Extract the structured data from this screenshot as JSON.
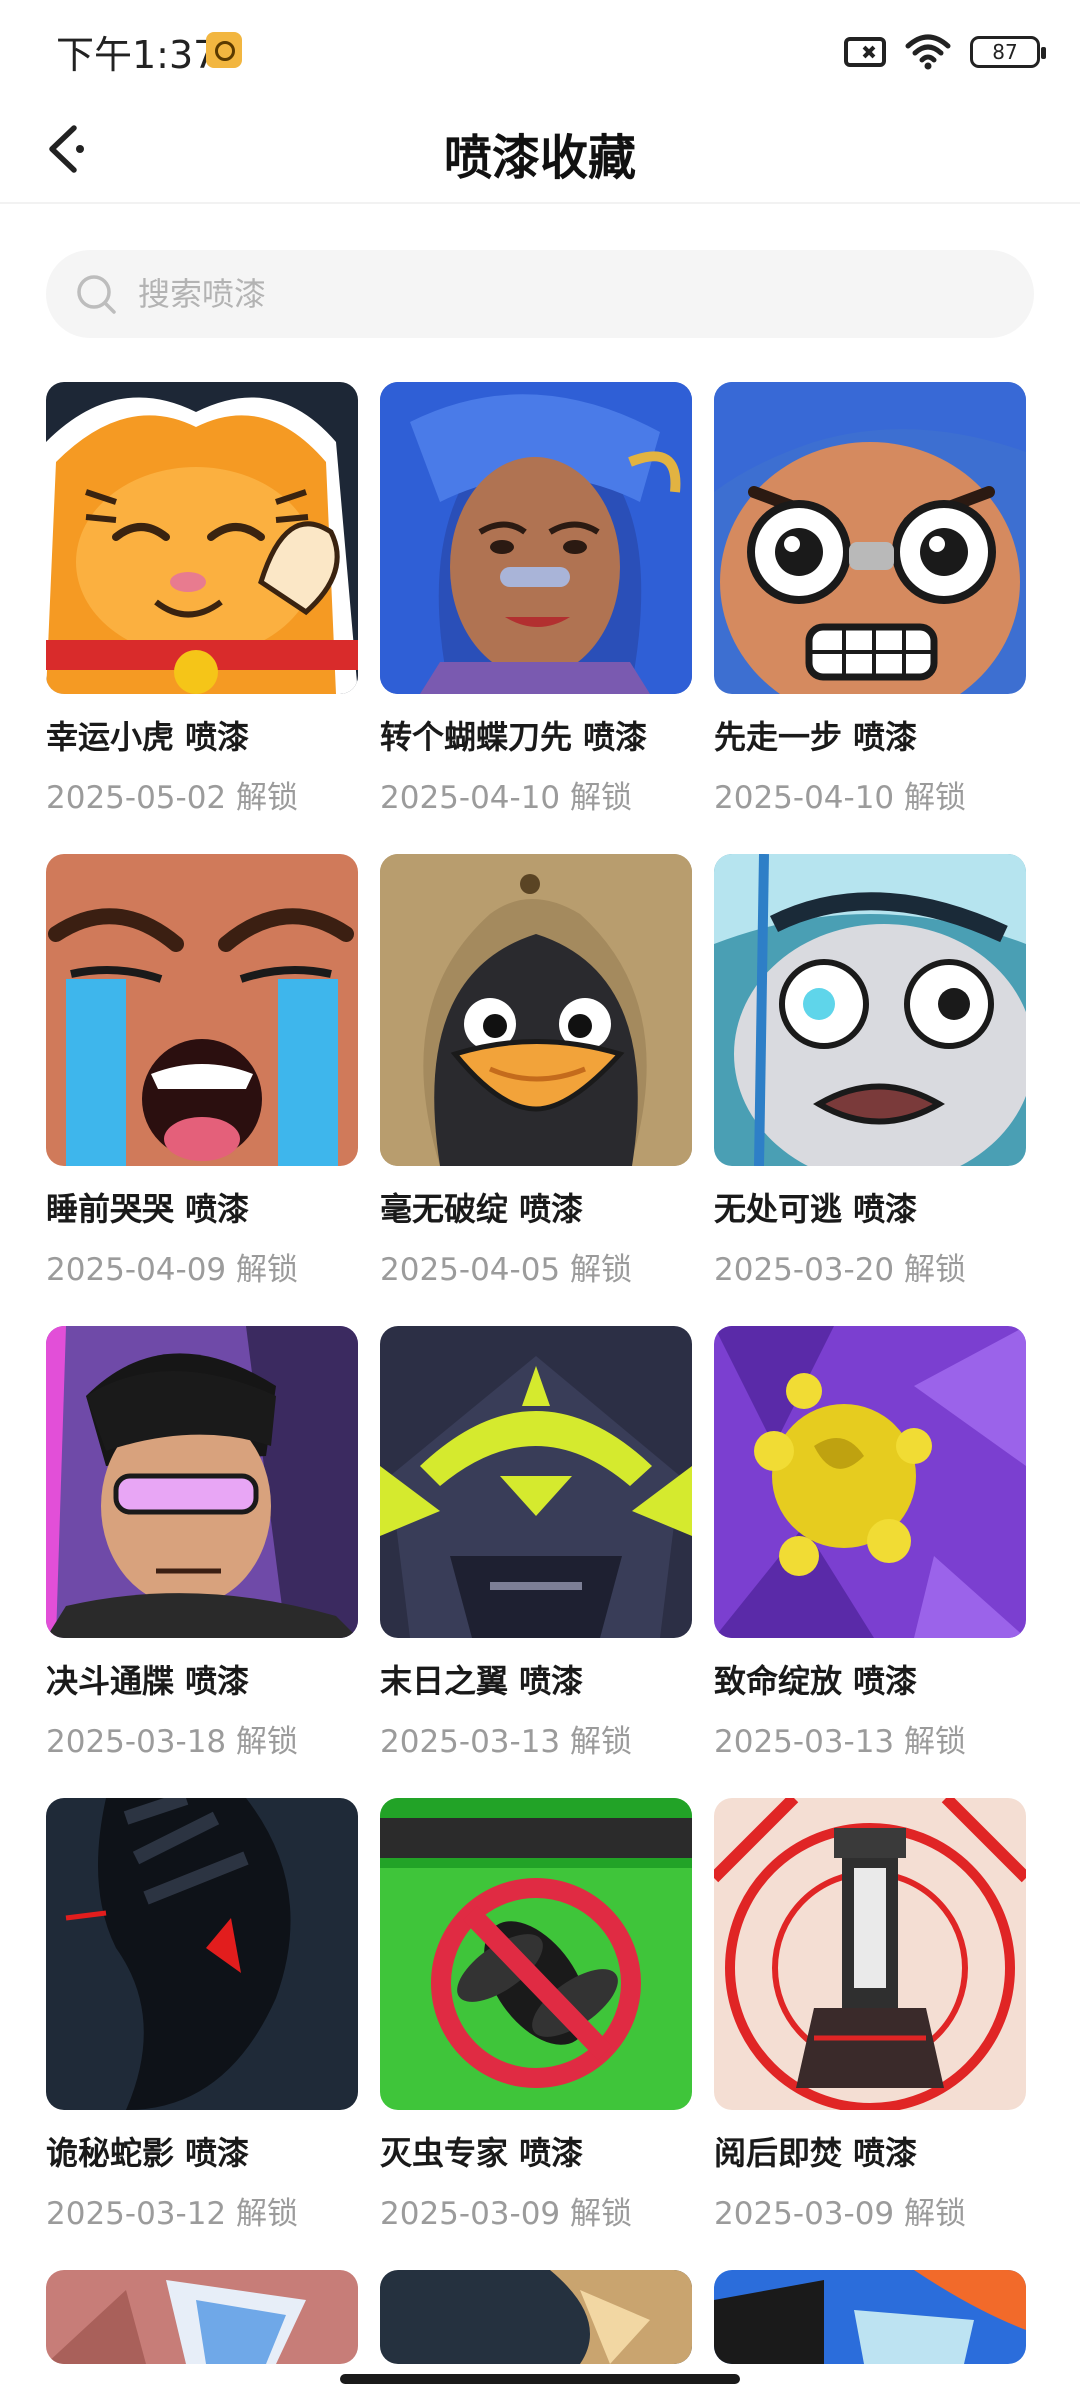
{
  "status_bar": {
    "time": "下午1:37",
    "battery": "87"
  },
  "header": {
    "title": "喷漆收藏"
  },
  "search": {
    "placeholder": "搜索喷漆",
    "value": ""
  },
  "items": [
    {
      "title": "幸运小虎 喷漆",
      "subtitle": "2025-05-02 解锁",
      "image": "lucky-tiger-spray"
    },
    {
      "title": "转个蝴蝶刀先 喷漆",
      "subtitle": "2025-04-10 解锁",
      "image": "blue-hair-woman-spray"
    },
    {
      "title": "先走一步 喷漆",
      "subtitle": "2025-04-10 解锁",
      "image": "shocked-boy-spray"
    },
    {
      "title": "睡前哭哭 喷漆",
      "subtitle": "2025-04-09 解锁",
      "image": "crying-face-spray"
    },
    {
      "title": "毫无破绽 喷漆",
      "subtitle": "2025-04-05 解锁",
      "image": "penguin-spray"
    },
    {
      "title": "无处可逃 喷漆",
      "subtitle": "2025-03-20 解锁",
      "image": "scared-face-spray"
    },
    {
      "title": "决斗通牒 喷漆",
      "subtitle": "2025-03-18 解锁",
      "image": "visor-fighter-spray"
    },
    {
      "title": "末日之翼 喷漆",
      "subtitle": "2025-03-13 解锁",
      "image": "dark-robot-spray"
    },
    {
      "title": "致命绽放 喷漆",
      "subtitle": "2025-03-13 解锁",
      "image": "yellow-flower-spray"
    },
    {
      "title": "诡秘蛇影 喷漆",
      "subtitle": "2025-03-12 解锁",
      "image": "shadow-snake-spray"
    },
    {
      "title": "灭虫专家 喷漆",
      "subtitle": "2025-03-09 解锁",
      "image": "no-bug-spray"
    },
    {
      "title": "阅后即焚 喷漆",
      "subtitle": "2025-03-09 解锁",
      "image": "red-target-spray"
    },
    {
      "title": "",
      "subtitle": "",
      "image": "partial-pink-spray"
    },
    {
      "title": "",
      "subtitle": "",
      "image": "partial-dark-spray"
    },
    {
      "title": "",
      "subtitle": "",
      "image": "partial-blue-spray"
    }
  ]
}
